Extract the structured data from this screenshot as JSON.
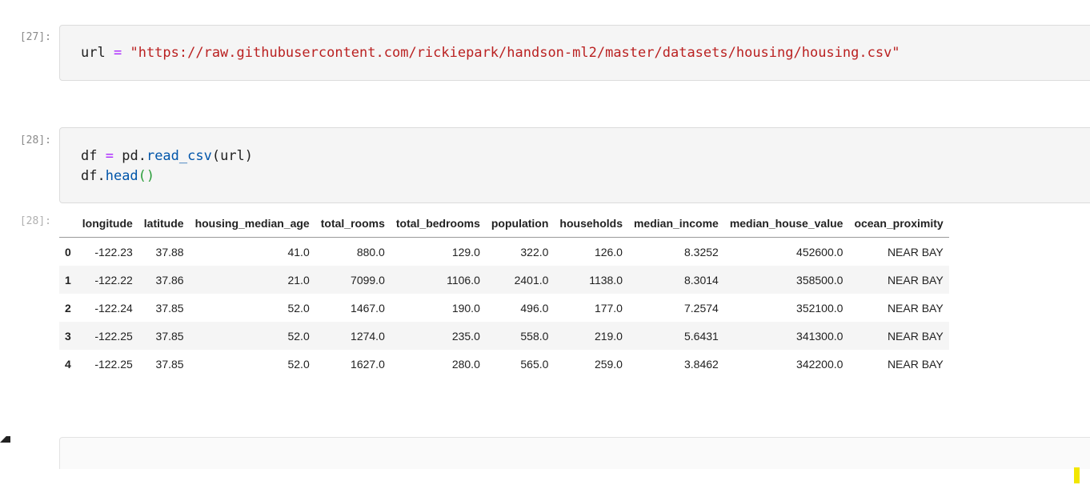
{
  "cells": [
    {
      "prompt": "[27]:",
      "code_lines": [
        {
          "var": "url",
          "op": "=",
          "str": "\"https://raw.githubusercontent.com/rickiepark/handson-ml2/master/datasets/housing/housing.csv\""
        }
      ]
    },
    {
      "prompt": "[28]:",
      "code_lines": [
        {
          "var": "df",
          "op": "=",
          "obj": "pd.",
          "fn": "read_csv",
          "args": "(url)"
        },
        {
          "obj": "df.",
          "fn": "head",
          "args": "()"
        }
      ],
      "output_prompt": "[28]:"
    }
  ],
  "dataframe": {
    "columns": [
      "",
      "longitude",
      "latitude",
      "housing_median_age",
      "total_rooms",
      "total_bedrooms",
      "population",
      "households",
      "median_income",
      "median_house_value",
      "ocean_proximity"
    ],
    "rows": [
      [
        "0",
        "-122.23",
        "37.88",
        "41.0",
        "880.0",
        "129.0",
        "322.0",
        "126.0",
        "8.3252",
        "452600.0",
        "NEAR BAY"
      ],
      [
        "1",
        "-122.22",
        "37.86",
        "21.0",
        "7099.0",
        "1106.0",
        "2401.0",
        "1138.0",
        "8.3014",
        "358500.0",
        "NEAR BAY"
      ],
      [
        "2",
        "-122.24",
        "37.85",
        "52.0",
        "1467.0",
        "190.0",
        "496.0",
        "177.0",
        "7.2574",
        "352100.0",
        "NEAR BAY"
      ],
      [
        "3",
        "-122.25",
        "37.85",
        "52.0",
        "1274.0",
        "235.0",
        "558.0",
        "219.0",
        "5.6431",
        "341300.0",
        "NEAR BAY"
      ],
      [
        "4",
        "-122.25",
        "37.85",
        "52.0",
        "1627.0",
        "280.0",
        "565.0",
        "259.0",
        "3.8462",
        "342200.0",
        "NEAR BAY"
      ]
    ]
  },
  "colors": {
    "operator": "#aa22ff",
    "string": "#ba2121",
    "function": "#0055aa",
    "paren_highlight": "#2a9d3a",
    "cursor": "#f2e600"
  }
}
